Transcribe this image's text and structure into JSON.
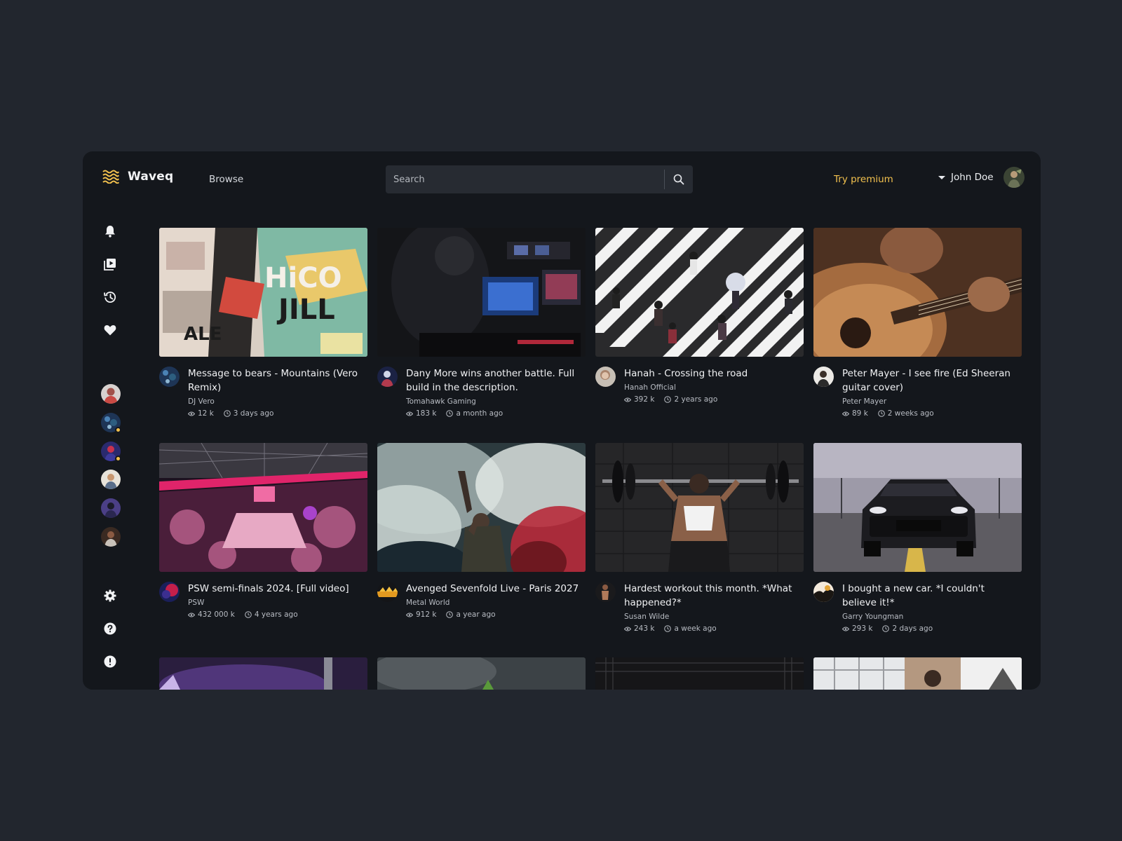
{
  "app": {
    "name": "Waveq",
    "browse_label": "Browse",
    "search_placeholder": "Search",
    "premium_label": "Try premium",
    "user_name": "John Doe",
    "accent_color": "#f2c14e"
  },
  "sidebar": {
    "nav_icons": [
      "bell-icon",
      "playlist-icon",
      "history-icon",
      "heart-icon"
    ],
    "subscriptions": [
      {
        "icon": "avatar",
        "online": false
      },
      {
        "icon": "avatar",
        "online": true
      },
      {
        "icon": "avatar",
        "online": true
      },
      {
        "icon": "avatar",
        "online": false
      },
      {
        "icon": "avatar",
        "online": false
      },
      {
        "icon": "avatar",
        "online": false
      }
    ],
    "bottom_icons": [
      "settings-icon",
      "help-icon",
      "alert-icon"
    ]
  },
  "videos": [
    {
      "title": "Message to bears - Mountains (Vero Remix)",
      "channel": "DJ Vero",
      "views": "12 k",
      "age": "3 days ago"
    },
    {
      "title": "Dany More wins another battle. Full build in the description.",
      "channel": "Tomahawk Gaming",
      "views": "183 k",
      "age": "a month ago"
    },
    {
      "title": "Hanah - Crossing the road",
      "channel": "Hanah Official",
      "views": "392 k",
      "age": "2 years ago"
    },
    {
      "title": "Peter Mayer - I see fire (Ed Sheeran guitar cover)",
      "channel": "Peter Mayer",
      "views": "89 k",
      "age": "2 weeks ago"
    },
    {
      "title": "PSW semi-finals 2024. [Full video]",
      "channel": "PSW",
      "views": "432 000 k",
      "age": "4 years ago"
    },
    {
      "title": "Avenged Sevenfold Live - Paris 2027",
      "channel": "Metal World",
      "views": "912 k",
      "age": "a year ago"
    },
    {
      "title": "Hardest workout this month. *What happened?*",
      "channel": "Susan Wilde",
      "views": "243 k",
      "age": "a week ago"
    },
    {
      "title": "I bought a new car. *I couldn't believe it!*",
      "channel": "Garry Youngman",
      "views": "293 k",
      "age": "2 days ago"
    }
  ]
}
